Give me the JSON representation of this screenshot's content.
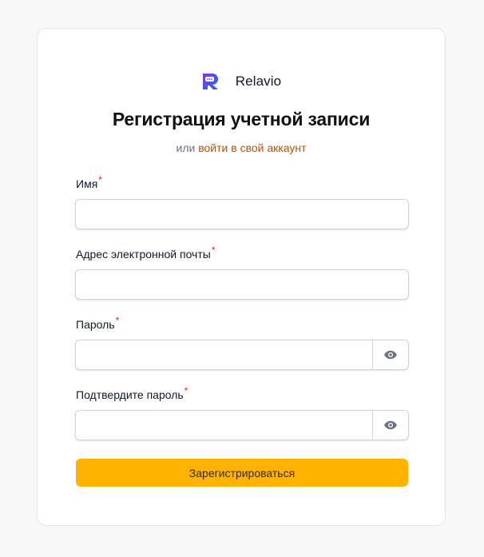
{
  "brand": {
    "name": "Relavio"
  },
  "header": {
    "title": "Регистрация учетной записи",
    "subtitle_prefix": "или",
    "login_link": "войти в свой аккаунт"
  },
  "form": {
    "name": {
      "label": "Имя",
      "required": "*",
      "value": "",
      "placeholder": ""
    },
    "email": {
      "label": "Адрес электронной почты",
      "required": "*",
      "value": "",
      "placeholder": ""
    },
    "password": {
      "label": "Пароль",
      "required": "*",
      "value": "",
      "placeholder": "",
      "toggle_icon": "eye-icon"
    },
    "confirm_password": {
      "label": "Подтвердите пароль",
      "required": "*",
      "value": "",
      "placeholder": "",
      "toggle_icon": "eye-icon"
    },
    "submit_label": "Зарегистрироваться"
  },
  "colors": {
    "accent": "#ffb300",
    "link": "#b45309",
    "required": "#dc2626",
    "logo_gradient_start": "#6d28d9",
    "logo_gradient_end": "#2563eb"
  }
}
